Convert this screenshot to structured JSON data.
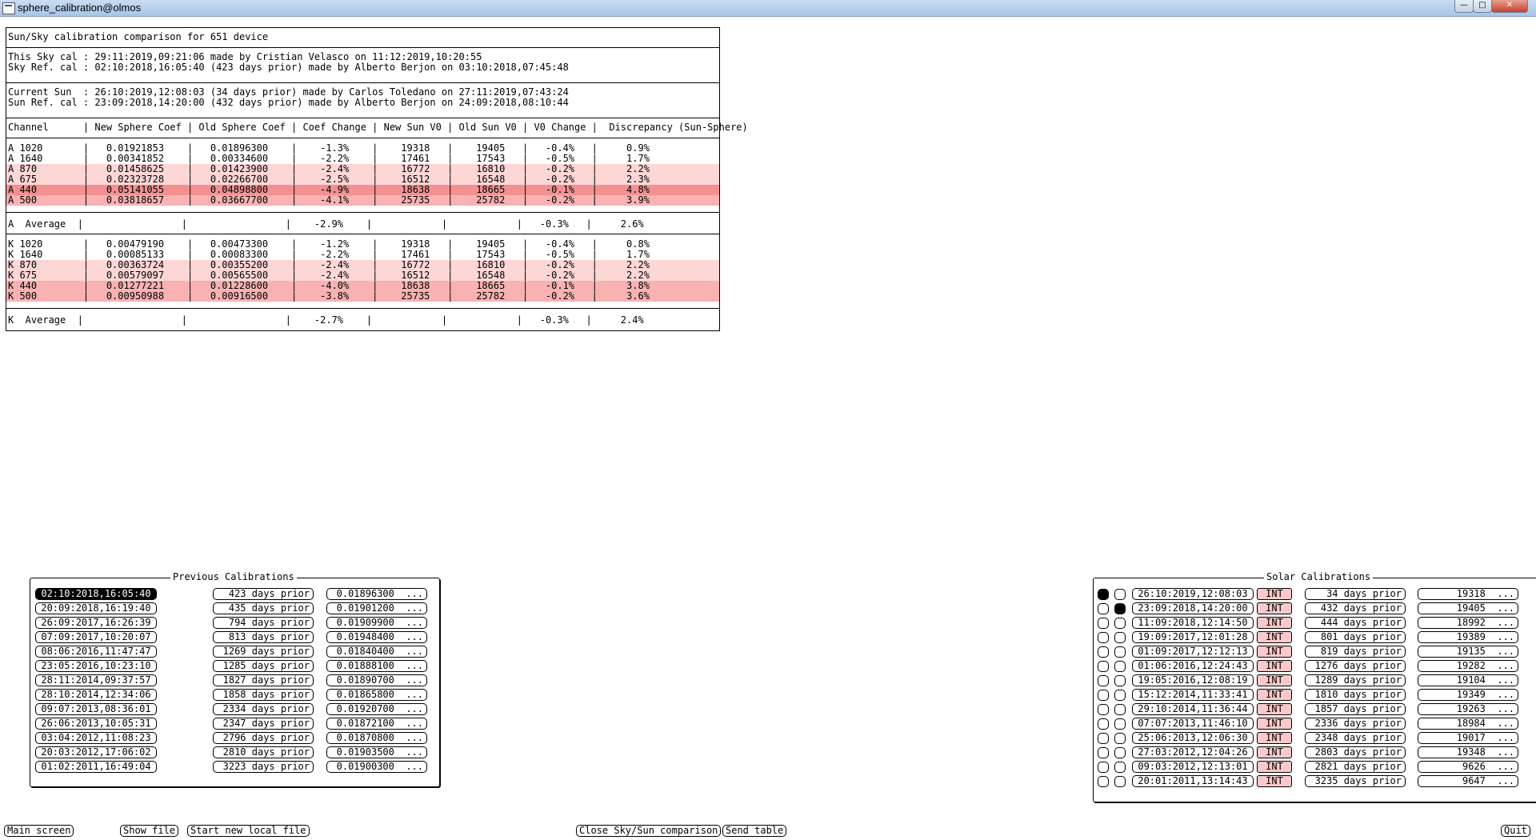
{
  "window": {
    "title": "sphere_calibration@olmos"
  },
  "report": {
    "heading": "Sun/Sky calibration comparison for 651 device",
    "sky": [
      "This Sky cal : 29:11:2019,09:21:06 made by Cristian Velasco on 11:12:2019,10:20:55",
      "Sky Ref. cal : 02:10:2018,16:05:40 (423 days prior) made by Alberto Berjon on 03:10:2018,07:45:48"
    ],
    "sun": [
      "Current Sun  : 26:10:2019,12:08:03 (34 days prior) made by Carlos Toledano on 27:11:2019,07:43:24",
      "Sun Ref. cal : 23:09:2018,14:20:00 (432 days prior) made by Alberto Berjon on 24:09:2018,08:10:44"
    ],
    "columns": "Channel      | New Sphere Coef | Old Sphere Coef | Coef Change | New Sun V0 | Old Sun V0 | V0 Change |  Discrepancy (Sun-Sphere)",
    "a_rows": [
      {
        "text": "A 1020       |   0.01921853    |   0.01896300    |    -1.3%    |    19318   |    19405   |   -0.4%   |     0.9%",
        "level": "none"
      },
      {
        "text": "A 1640       |   0.00341852    |   0.00334600    |    -2.2%    |    17461   |    17543   |   -0.5%   |     1.7%",
        "level": "none"
      },
      {
        "text": "A 870        |   0.01458625    |   0.01423900    |    -2.4%    |    16772   |    16810   |   -0.2%   |     2.2%",
        "level": "light"
      },
      {
        "text": "A 675        |   0.02323728    |   0.02266700    |    -2.5%    |    16512   |    16548   |   -0.2%   |     2.3%",
        "level": "light"
      },
      {
        "text": "A 440        |   0.05141055    |   0.04898800    |    -4.9%    |    18638   |    18665   |   -0.1%   |     4.8%",
        "level": "dark"
      },
      {
        "text": "A 500        |   0.03818657    |   0.03667700    |    -4.1%    |    25735   |    25782   |   -0.2%   |     3.9%",
        "level": "mid"
      }
    ],
    "a_average": "A  Average  |                 |                 |    -2.9%    |            |            |   -0.3%   |     2.6%",
    "k_rows": [
      {
        "text": "K 1020       |   0.00479190    |   0.00473300    |    -1.2%    |    19318   |    19405   |   -0.4%   |     0.8%",
        "level": "none"
      },
      {
        "text": "K 1640       |   0.00085133    |   0.00083300    |    -2.2%    |    17461   |    17543   |   -0.5%   |     1.7%",
        "level": "none"
      },
      {
        "text": "K 870        |   0.00363724    |   0.00355200    |    -2.4%    |    16772   |    16810   |   -0.2%   |     2.2%",
        "level": "light"
      },
      {
        "text": "K 675        |   0.00579097    |   0.00565500    |    -2.4%    |    16512   |    16548   |   -0.2%   |     2.2%",
        "level": "light"
      },
      {
        "text": "K 440        |   0.01277221    |   0.01228600    |    -4.0%    |    18638   |    18665   |   -0.1%   |     3.8%",
        "level": "mid"
      },
      {
        "text": "K 500        |   0.00950988    |   0.00916500    |    -3.8%    |    25735   |    25782   |   -0.2%   |     3.6%",
        "level": "mid"
      }
    ],
    "k_average": "K  Average  |                 |                 |    -2.7%    |            |            |   -0.3%   |     2.4%"
  },
  "previous": {
    "title": "Previous Calibrations",
    "items": [
      {
        "date": "02:10:2018,16:05:40",
        "prior": "423 days prior",
        "coef": "0.01896300  ...",
        "selected": true
      },
      {
        "date": "20:09:2018,16:19:40",
        "prior": "435 days prior",
        "coef": "0.01901200  ...",
        "selected": false
      },
      {
        "date": "26:09:2017,16:26:39",
        "prior": "794 days prior",
        "coef": "0.01909900  ...",
        "selected": false
      },
      {
        "date": "07:09:2017,10:20:07",
        "prior": "813 days prior",
        "coef": "0.01948400  ...",
        "selected": false
      },
      {
        "date": "08:06:2016,11:47:47",
        "prior": "1269 days prior",
        "coef": "0.01840400  ...",
        "selected": false
      },
      {
        "date": "23:05:2016,10:23:10",
        "prior": "1285 days prior",
        "coef": "0.01888100  ...",
        "selected": false
      },
      {
        "date": "28:11:2014,09:37:57",
        "prior": "1827 days prior",
        "coef": "0.01890700  ...",
        "selected": false
      },
      {
        "date": "28:10:2014,12:34:06",
        "prior": "1858 days prior",
        "coef": "0.01865800  ...",
        "selected": false
      },
      {
        "date": "09:07:2013,08:36:01",
        "prior": "2334 days prior",
        "coef": "0.01920700  ...",
        "selected": false
      },
      {
        "date": "26:06:2013,10:05:31",
        "prior": "2347 days prior",
        "coef": "0.01872100  ...",
        "selected": false
      },
      {
        "date": "03:04:2012,11:08:23",
        "prior": "2796 days prior",
        "coef": "0.01870800  ...",
        "selected": false
      },
      {
        "date": "20:03:2012,17:06:02",
        "prior": "2810 days prior",
        "coef": "0.01903500  ...",
        "selected": false
      },
      {
        "date": "01:02:2011,16:49:04",
        "prior": "3223 days prior",
        "coef": "0.01900300  ...",
        "selected": false
      }
    ]
  },
  "solar": {
    "title": "Solar Calibrations",
    "items": [
      {
        "date": "26:10:2019,12:08:03",
        "tag": "INT",
        "prior": "34 days prior",
        "v0": "19318  ...",
        "current": true,
        "reference": false
      },
      {
        "date": "23:09:2018,14:20:00",
        "tag": "INT",
        "prior": "432 days prior",
        "v0": "19405  ...",
        "current": false,
        "reference": true
      },
      {
        "date": "11:09:2018,12:14:50",
        "tag": "INT",
        "prior": "444 days prior",
        "v0": "18992  ...",
        "current": false,
        "reference": false
      },
      {
        "date": "19:09:2017,12:01:28",
        "tag": "INT",
        "prior": "801 days prior",
        "v0": "19389  ...",
        "current": false,
        "reference": false
      },
      {
        "date": "01:09:2017,12:12:13",
        "tag": "INT",
        "prior": "819 days prior",
        "v0": "19135  ...",
        "current": false,
        "reference": false
      },
      {
        "date": "01:06:2016,12:24:43",
        "tag": "INT",
        "prior": "1276 days prior",
        "v0": "19282  ...",
        "current": false,
        "reference": false
      },
      {
        "date": "19:05:2016,12:08:19",
        "tag": "INT",
        "prior": "1289 days prior",
        "v0": "19104  ...",
        "current": false,
        "reference": false
      },
      {
        "date": "15:12:2014,11:33:41",
        "tag": "INT",
        "prior": "1810 days prior",
        "v0": "19349  ...",
        "current": false,
        "reference": false
      },
      {
        "date": "29:10:2014,11:36:44",
        "tag": "INT",
        "prior": "1857 days prior",
        "v0": "19263  ...",
        "current": false,
        "reference": false
      },
      {
        "date": "07:07:2013,11:46:10",
        "tag": "INT",
        "prior": "2336 days prior",
        "v0": "18984  ...",
        "current": false,
        "reference": false
      },
      {
        "date": "25:06:2013,12:06:30",
        "tag": "INT",
        "prior": "2348 days prior",
        "v0": "19017  ...",
        "current": false,
        "reference": false
      },
      {
        "date": "27:03:2012,12:04:26",
        "tag": "INT",
        "prior": "2803 days prior",
        "v0": "19348  ...",
        "current": false,
        "reference": false
      },
      {
        "date": "09:03:2012,12:13:01",
        "tag": "INT",
        "prior": "2821 days prior",
        "v0": "9626  ...",
        "current": false,
        "reference": false
      },
      {
        "date": "20:01:2011,13:14:43",
        "tag": "INT",
        "prior": "3235 days prior",
        "v0": "9647  ...",
        "current": false,
        "reference": false
      }
    ]
  },
  "buttons": {
    "main_screen": "Main screen",
    "show_file": "Show file",
    "start_new_local_file": "Start new local file",
    "close_comparison": "Close Sky/Sun comparison",
    "send_table": "Send table",
    "quit": "Quit"
  }
}
